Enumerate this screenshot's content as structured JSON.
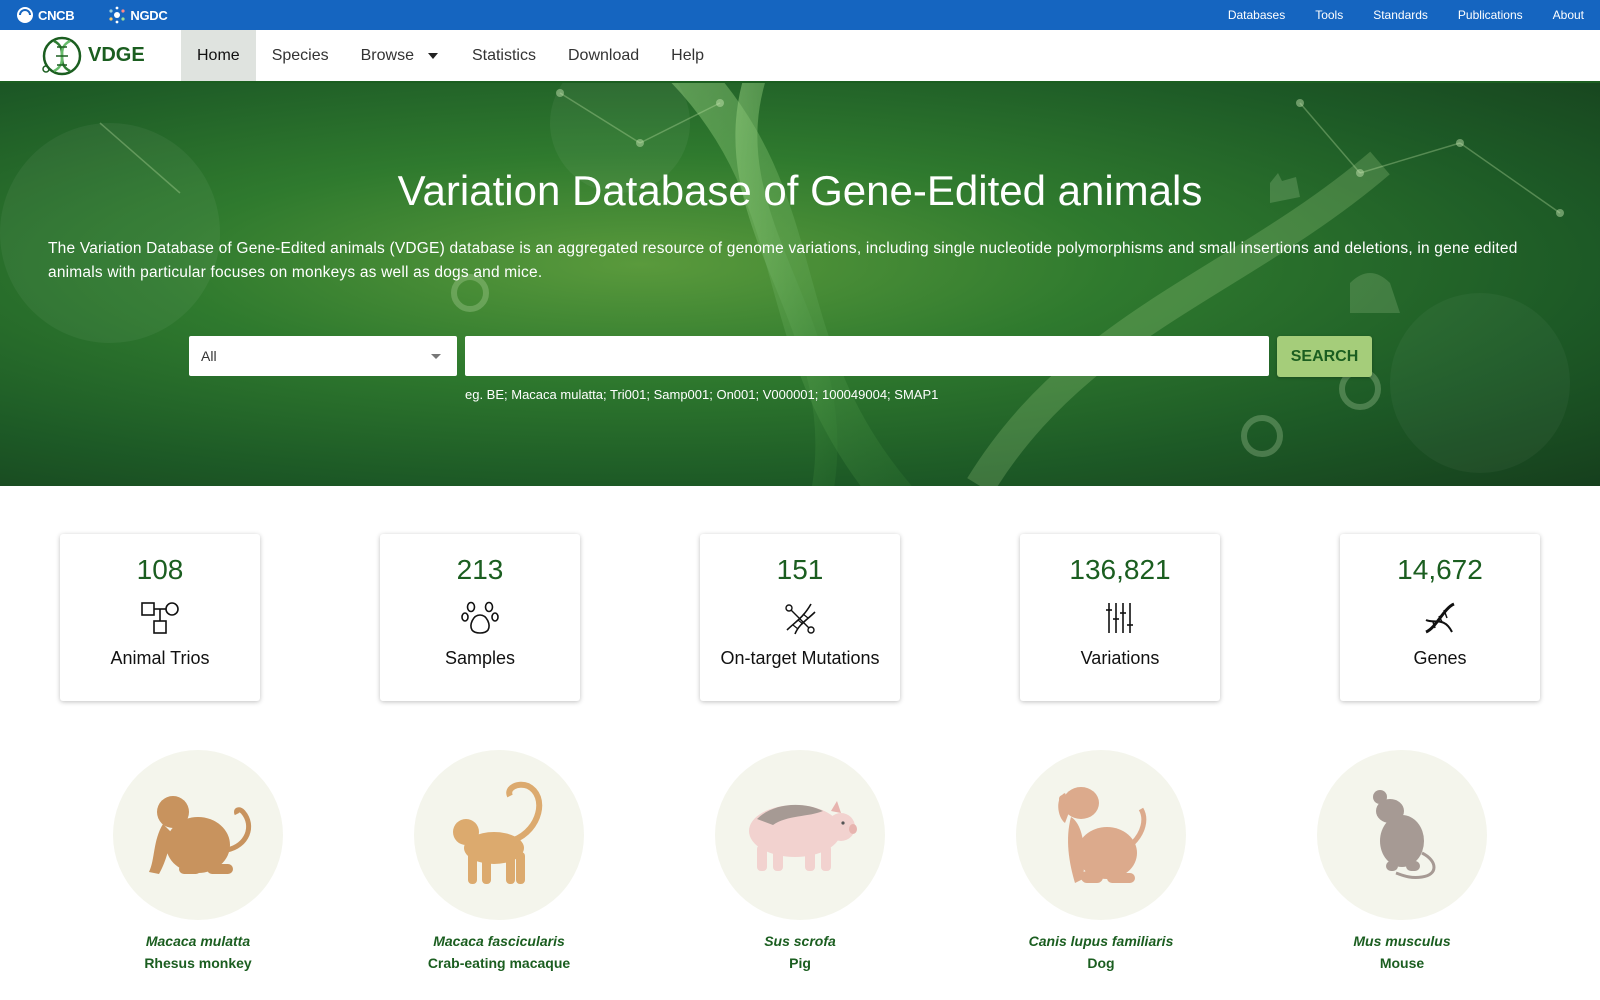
{
  "topbar": {
    "orgs": [
      "CNCB",
      "NGDC"
    ],
    "links": [
      "Databases",
      "Tools",
      "Standards",
      "Publications",
      "About"
    ]
  },
  "navbar": {
    "logo": "VDGE",
    "items": [
      "Home",
      "Species",
      "Browse",
      "Statistics",
      "Download",
      "Help"
    ],
    "active": "Home"
  },
  "hero": {
    "title": "Variation Database of Gene-Edited animals",
    "description": "The Variation Database of Gene-Edited animals (VDGE) database is an aggregated resource of genome variations, including single nucleotide polymorphisms and small insertions and deletions, in gene edited animals with particular focuses on monkeys as well as dogs and mice.",
    "search": {
      "select_value": "All",
      "input_value": "",
      "button_label": "SEARCH",
      "hint": "eg. BE; Macaca mulatta; Tri001; Samp001; On001; V000001; 100049004; SMAP1"
    }
  },
  "stats": [
    {
      "value": "108",
      "label": "Animal Trios",
      "icon": "trio-icon"
    },
    {
      "value": "213",
      "label": "Samples",
      "icon": "paw-icon"
    },
    {
      "value": "151",
      "label": "On-target Mutations",
      "icon": "dna-scissors-icon"
    },
    {
      "value": "136,821",
      "label": "Variations",
      "icon": "variation-bars-icon"
    },
    {
      "value": "14,672",
      "label": "Genes",
      "icon": "dna-icon"
    }
  ],
  "species": [
    {
      "scientific": "Macaca mulatta",
      "common": "Rhesus monkey",
      "icon": "rhesus-monkey-icon"
    },
    {
      "scientific": "Macaca fascicularis",
      "common": "Crab-eating macaque",
      "icon": "macaque-icon"
    },
    {
      "scientific": "Sus scrofa",
      "common": "Pig",
      "icon": "pig-icon"
    },
    {
      "scientific": "Canis lupus familiaris",
      "common": "Dog",
      "icon": "dog-icon"
    },
    {
      "scientific": "Mus musculus",
      "common": "Mouse",
      "icon": "mouse-icon"
    }
  ],
  "colors": {
    "topbar": "#1565c0",
    "brand_green": "#1b5e20",
    "search_button": "#a5cd7a",
    "species_circle": "#f4f5ec",
    "animal_tan": "#c8935e",
    "pig_pink": "#f2d2cf",
    "mouse_gray": "#a69a94"
  }
}
